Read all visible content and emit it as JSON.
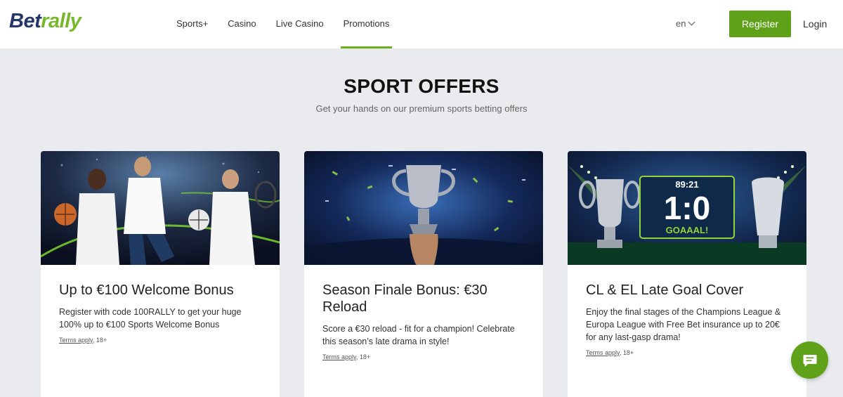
{
  "brand": {
    "name_part1": "Bet",
    "name_part2": "rally"
  },
  "nav": [
    {
      "label": "Sports+",
      "active": false
    },
    {
      "label": "Casino",
      "active": false
    },
    {
      "label": "Live Casino",
      "active": false
    },
    {
      "label": "Promotions",
      "active": true
    }
  ],
  "language": "en",
  "register_label": "Register",
  "login_label": "Login",
  "hero": {
    "title": "SPORT OFFERS",
    "subtitle": "Get your hands on our premium sports betting offers"
  },
  "offers": [
    {
      "title": "Up to €100 Welcome Bonus",
      "description": "Register with code 100RALLY to get your huge 100% up to €100 Sports Welcome Bonus",
      "terms_link": "Terms apply",
      "terms_suffix": ", 18+"
    },
    {
      "title": "Season Finale Bonus: €30 Reload",
      "description": "Score a €30 reload - fit for a champion! Celebrate this season’s late drama in style!",
      "terms_link": "Terms apply",
      "terms_suffix": ", 18+"
    },
    {
      "title": "CL & EL Late Goal Cover",
      "description": "Enjoy the final stages of the Champions League & Europa League with Free Bet insurance up to 20€ for any last-gasp drama!",
      "terms_link": "Terms apply",
      "terms_suffix": ", 18+"
    }
  ],
  "scoreboard": {
    "clock": "89:21",
    "score": "1:0",
    "caption": "GOAAAL!"
  },
  "icons": {
    "chat": "chat-bubble-icon",
    "language_toggle": "chevron-down-icon"
  },
  "colors": {
    "accent": "#5fa219",
    "brand_navy": "#26366b",
    "brand_green": "#76b82a",
    "page_bg": "#e9ebee"
  }
}
